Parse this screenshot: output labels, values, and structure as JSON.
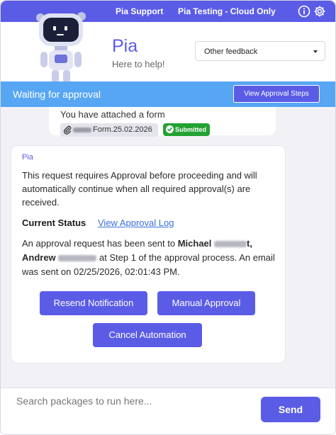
{
  "topbar": {
    "support_link": "Pia Support",
    "testing_link": "Pia Testing - Cloud Only",
    "info_icon": "info-icon",
    "settings_icon": "gear-icon"
  },
  "header": {
    "title": "Pia",
    "subtitle": "Here to help!",
    "feedback_select": {
      "value": "Other feedback"
    }
  },
  "banner": {
    "text": "Waiting for approval",
    "button_label": "View Approval Steps"
  },
  "previous_message": {
    "text": "You have attached a form",
    "attachment_name": "Form.25.02.2026",
    "badge": "Submitted"
  },
  "message": {
    "sender": "Pia",
    "body": "This request requires Approval before proceeding and will automatically continue when all required approval(s) are received.",
    "status_label": "Current Status",
    "status_link": "View Approval Log",
    "detail_prefix": "An approval request has been sent to ",
    "approver_1": "Michael",
    "approver_1_suffix": "t,",
    "approver_2": "Andrew",
    "detail_suffix": " at Step 1 of the approval process. An email was sent on 02/25/2026, 02:01:43 PM.",
    "buttons": {
      "resend": "Resend Notification",
      "manual": "Manual Approval",
      "cancel": "Cancel Automation"
    }
  },
  "input": {
    "placeholder": "Search packages to run here...",
    "send_label": "Send"
  },
  "colors": {
    "primary": "#5b5ce6",
    "banner": "#57a6f4",
    "success": "#22a232",
    "link": "#3a6fe0"
  }
}
